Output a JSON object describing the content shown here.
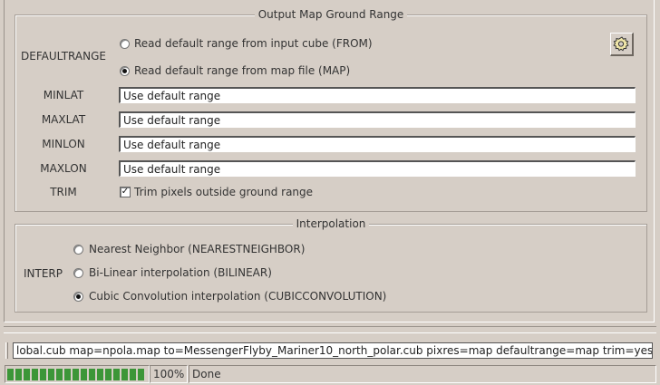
{
  "ground_range": {
    "title": "Output Map Ground Range",
    "defaultrange": {
      "label": "DEFAULTRANGE",
      "options": [
        {
          "label": "Read default range from input cube (FROM)",
          "selected": false
        },
        {
          "label": "Read default range from map file (MAP)",
          "selected": true
        }
      ]
    },
    "fields": [
      {
        "label": "MINLAT",
        "value": "Use default range"
      },
      {
        "label": "MAXLAT",
        "value": "Use default range"
      },
      {
        "label": "MINLON",
        "value": "Use default range"
      },
      {
        "label": "MAXLON",
        "value": "Use default range"
      }
    ],
    "trim": {
      "label": "TRIM",
      "checkbox_label": "Trim pixels outside ground range",
      "checked": true
    },
    "settings_button_icon": "gear-icon"
  },
  "interpolation": {
    "title": "Interpolation",
    "label": "INTERP",
    "options": [
      {
        "label": "Nearest Neighbor (NEARESTNEIGHBOR)",
        "selected": false
      },
      {
        "label": "Bi-Linear interpolation (BILINEAR)",
        "selected": false
      },
      {
        "label": "Cubic Convolution interpolation (CUBICCONVOLUTION)",
        "selected": true
      }
    ]
  },
  "command_line": "lobal.cub map=npola.map to=MessengerFlyby_Mariner10_north_polar.cub pixres=map defaultrange=map trim=yes",
  "status": {
    "progress_percent": 100,
    "progress_text": "100%",
    "message": "Done"
  },
  "colors": {
    "background": "#d6cec6",
    "progress": "#3c9638"
  }
}
